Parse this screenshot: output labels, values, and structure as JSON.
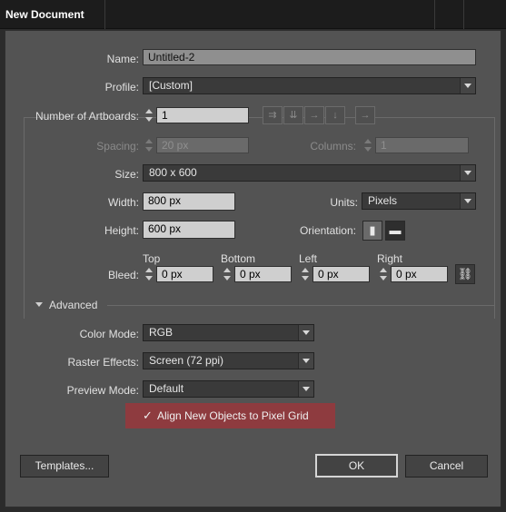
{
  "window": {
    "title": "New Document"
  },
  "name": {
    "label": "Name:",
    "value": "Untitled-2"
  },
  "profile": {
    "label": "Profile:",
    "value": "[Custom]"
  },
  "artboards": {
    "label": "Number of Artboards:",
    "value": "1"
  },
  "artboard_icons": [
    "grid-by-row-icon",
    "grid-by-column-icon",
    "arrange-by-row-icon",
    "arrange-by-column-icon",
    "right-to-left-icon"
  ],
  "spacing": {
    "label": "Spacing:",
    "value": "20 px"
  },
  "columns": {
    "label": "Columns:",
    "value": "1"
  },
  "size": {
    "label": "Size:",
    "value": "800 x 600"
  },
  "width": {
    "label": "Width:",
    "value": "800 px"
  },
  "units": {
    "label": "Units:",
    "value": "Pixels"
  },
  "height": {
    "label": "Height:",
    "value": "600 px"
  },
  "orientation": {
    "label": "Orientation:",
    "selected": "landscape"
  },
  "bleed": {
    "label": "Bleed:",
    "top": {
      "label": "Top",
      "value": "0 px"
    },
    "bottom": {
      "label": "Bottom",
      "value": "0 px"
    },
    "left": {
      "label": "Left",
      "value": "0 px"
    },
    "right": {
      "label": "Right",
      "value": "0 px"
    }
  },
  "advanced": {
    "label": "Advanced"
  },
  "color_mode": {
    "label": "Color Mode:",
    "value": "RGB"
  },
  "raster_effects": {
    "label": "Raster Effects:",
    "value": "Screen (72 ppi)"
  },
  "preview_mode": {
    "label": "Preview Mode:",
    "value": "Default"
  },
  "align_pixel_grid": {
    "label": "Align New Objects to Pixel Grid",
    "checked": true,
    "check_glyph": "✓"
  },
  "buttons": {
    "templates": "Templates...",
    "ok": "OK",
    "cancel": "Cancel"
  },
  "colors": {
    "dialog_bg": "#535353",
    "highlight": "#8e3b3f",
    "field_bg": "#cfcfcf"
  }
}
